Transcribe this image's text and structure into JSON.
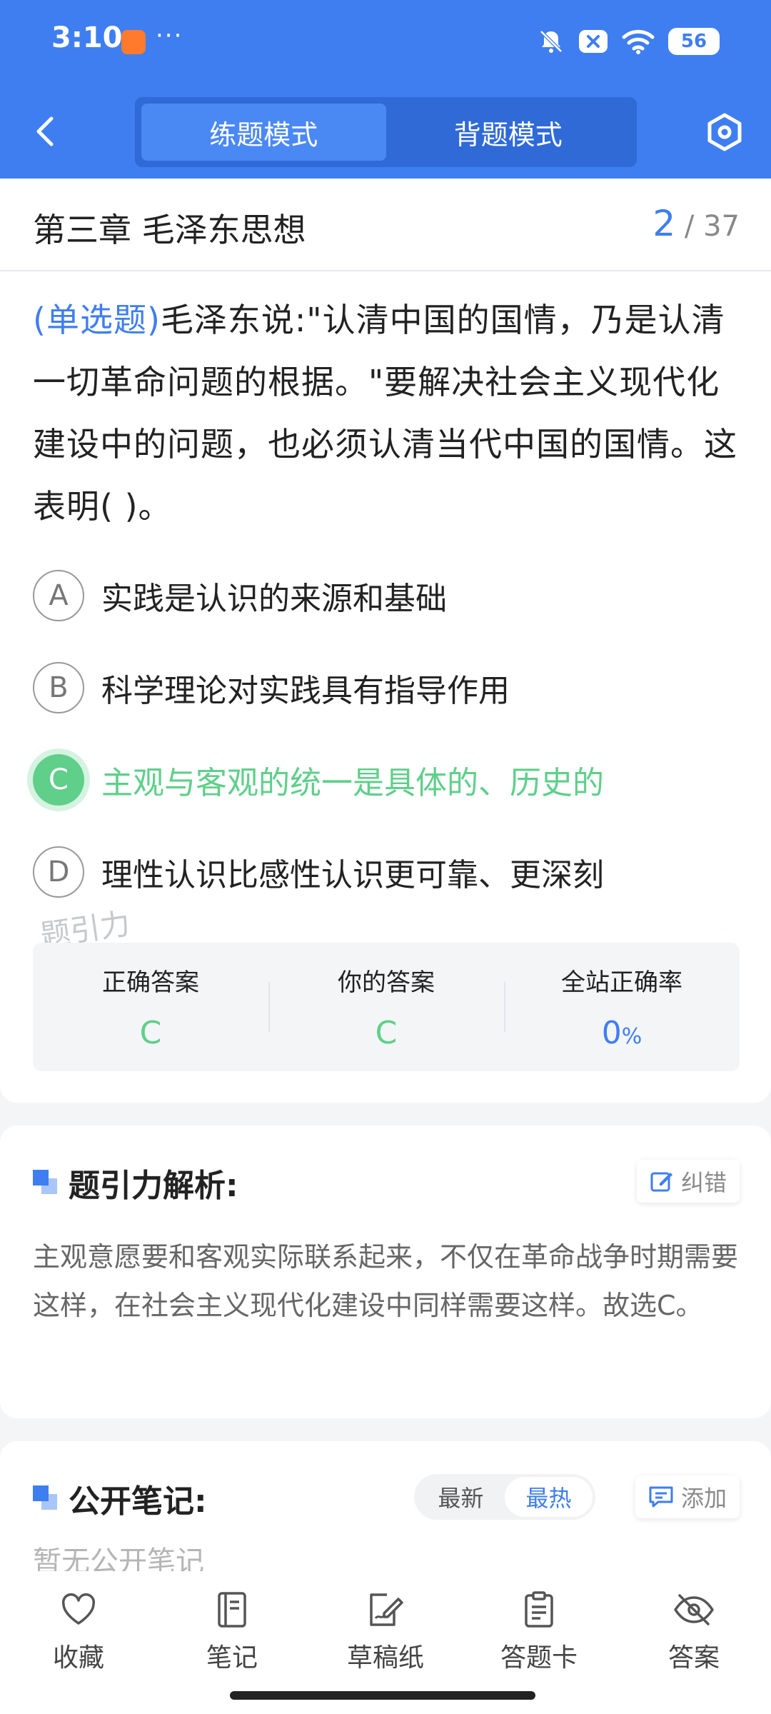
{
  "status_bar": {
    "time": "3:10",
    "more": "···",
    "battery": "56"
  },
  "header": {
    "tabs": [
      {
        "label": "练题模式",
        "active": true
      },
      {
        "label": "背题模式",
        "active": false
      }
    ],
    "back_icon": "chevron-left-icon",
    "settings_icon": "settings-hexagon-icon"
  },
  "chapter": {
    "title": "第三章 毛泽东思想",
    "current": "2",
    "total": "/ 37"
  },
  "question": {
    "type": "(单选题)",
    "text": "毛泽东说:\"认清中国的国情，乃是认清一切革命问题的根据。\"要解决社会主义现代化建设中的问题，也必须认清当代中国的国情。这表明(        )。"
  },
  "options": [
    {
      "letter": "A",
      "text": "实践是认识的来源和基础"
    },
    {
      "letter": "B",
      "text": "科学理论对实践具有指导作用"
    },
    {
      "letter": "C",
      "text": "主观与客观的统一是具体的、历史的"
    },
    {
      "letter": "D",
      "text": "理性认识比感性认识更可靠、更深刻"
    }
  ],
  "watermark": "题引力",
  "answer_summary": {
    "correct_label": "正确答案",
    "correct_value": "C",
    "yours_label": "你的答案",
    "yours_value": "C",
    "rate_label": "全站正确率",
    "rate_value": "0",
    "rate_unit": "%"
  },
  "analysis": {
    "title": "题引力解析:",
    "report_label": "纠错",
    "text": "主观意愿要和客观实际联系起来，不仅在革命战争时期需要这样，在社会主义现代化建设中同样需要这样。故选C。"
  },
  "notes": {
    "title": "公开笔记:",
    "sort_options": [
      "最新",
      "最热"
    ],
    "active_sort": "最热",
    "add_label": "添加",
    "empty_text": "暂无公开笔记"
  },
  "bottom_nav": [
    {
      "label": "收藏",
      "icon": "heart-icon"
    },
    {
      "label": "笔记",
      "icon": "notebook-icon"
    },
    {
      "label": "草稿纸",
      "icon": "draft-pen-icon"
    },
    {
      "label": "答题卡",
      "icon": "clipboard-icon"
    },
    {
      "label": "答案",
      "icon": "eye-off-icon"
    }
  ],
  "colors": {
    "primary": "#3f7ef0",
    "correct": "#5fcf8a",
    "muted_text": "#666666"
  }
}
